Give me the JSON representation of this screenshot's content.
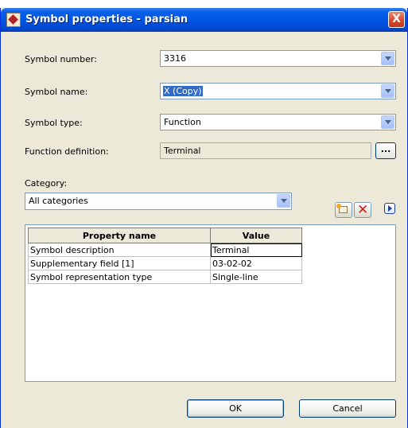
{
  "window": {
    "title": "Symbol properties - parsian",
    "close_label": "X"
  },
  "fields": {
    "symbol_number": {
      "label": "Symbol number:",
      "value": "3316"
    },
    "symbol_name": {
      "label": "Symbol name:",
      "value": "X (Copy)"
    },
    "symbol_type": {
      "label": "Symbol type:",
      "value": "Function"
    },
    "function_definition": {
      "label": "Function definition:",
      "value": "Terminal",
      "button_label": "..."
    }
  },
  "category": {
    "label": "Category:",
    "value": "All categories"
  },
  "toolbar": {
    "icons": [
      "new-property-icon",
      "delete-icon",
      "play-icon"
    ]
  },
  "properties_table": {
    "headers": [
      "Property name",
      "Value"
    ],
    "rows": [
      {
        "name": "Symbol description",
        "value": "Terminal"
      },
      {
        "name": "Supplementary field [1]",
        "value": "03-02-02"
      },
      {
        "name": "Symbol representation type",
        "value": "Single-line"
      }
    ]
  },
  "buttons": {
    "ok": "OK",
    "cancel": "Cancel"
  },
  "colors": {
    "titlebar": "#0055e5",
    "dialog_bg": "#ece9d8",
    "selection": "#316ac5"
  }
}
